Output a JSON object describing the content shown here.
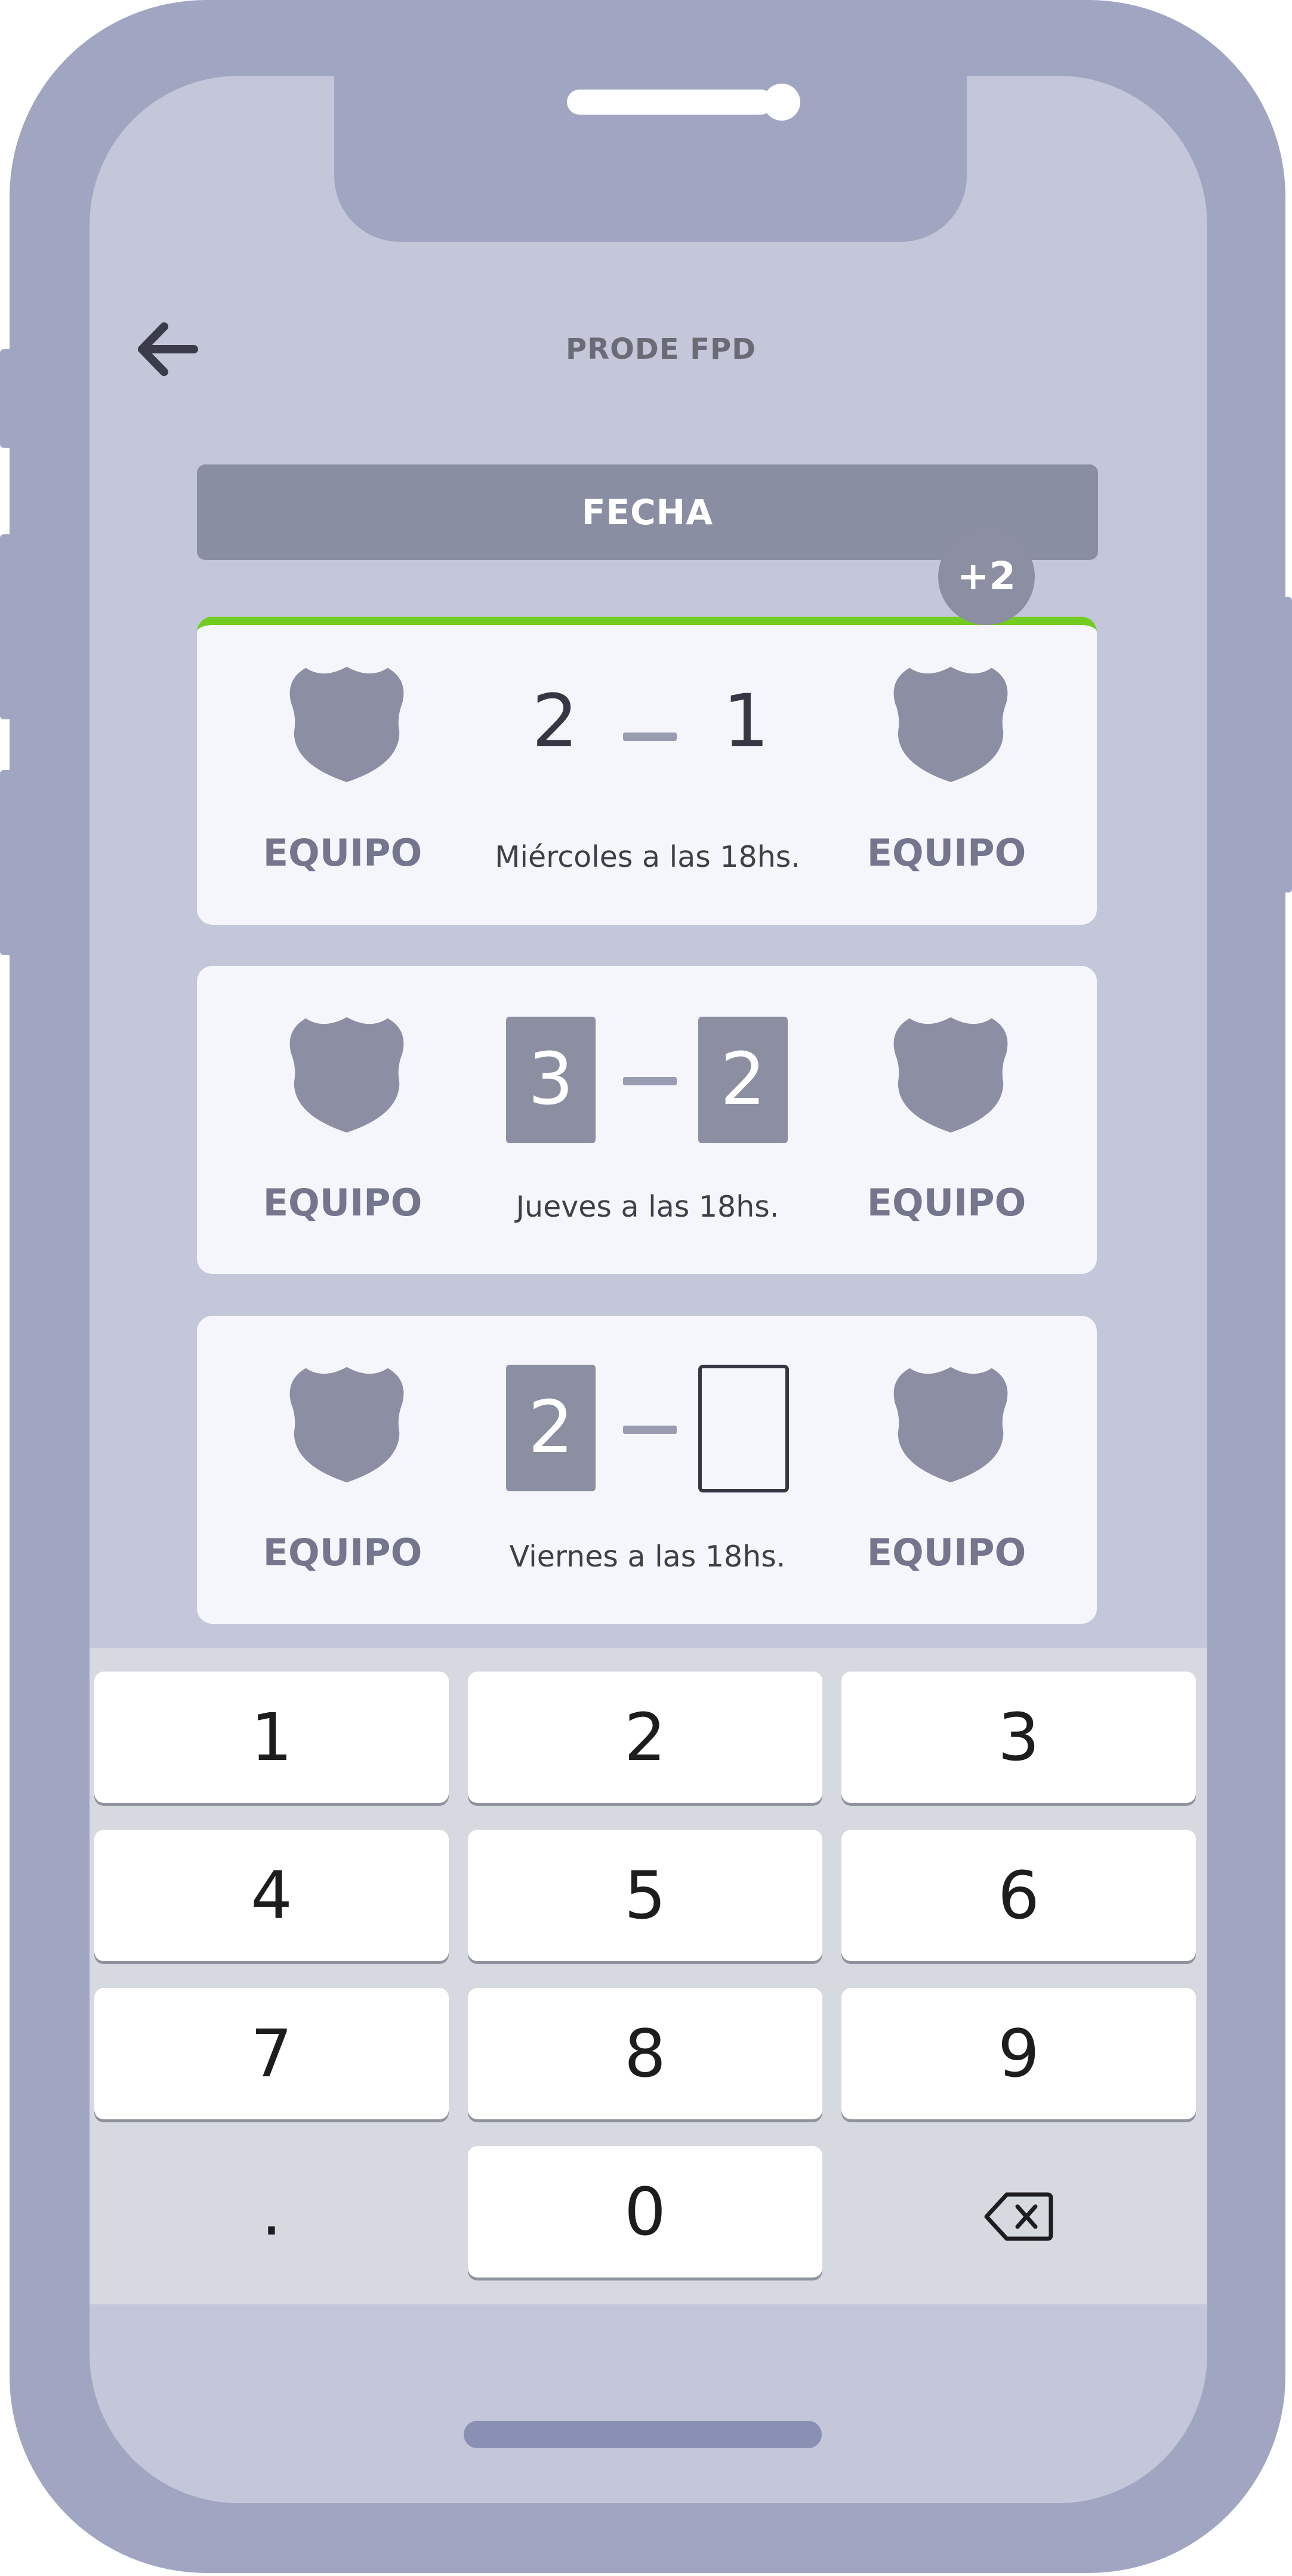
{
  "app": {
    "title": "PRODE FPD"
  },
  "header": {
    "back_icon": "arrow-left-icon",
    "round_label": "FECHA"
  },
  "matches": [
    {
      "home": "EQUIPO",
      "away": "EQUIPO",
      "home_score": "2",
      "away_score": "1",
      "schedule": "Miércoles a las 18hs.",
      "status": "played",
      "extra_badge": "+2"
    },
    {
      "home": "EQUIPO",
      "away": "EQUIPO",
      "home_score": "3",
      "away_score": "2",
      "schedule": "Jueves a las 18hs.",
      "status": "predicted"
    },
    {
      "home": "EQUIPO",
      "away": "EQUIPO",
      "home_score": "2",
      "away_score": "",
      "schedule": "Viernes a las 18hs.",
      "status": "editing"
    }
  ],
  "keypad": {
    "keys": [
      "1",
      "2",
      "3",
      "4",
      "5",
      "6",
      "7",
      "8",
      "9",
      ".",
      "0"
    ],
    "delete_icon": "backspace-icon"
  },
  "colors": {
    "accent_green": "#72cc22",
    "frame": "#a0a6c1",
    "screen": "#c4c7d9",
    "muted": "#8c8ea1"
  }
}
